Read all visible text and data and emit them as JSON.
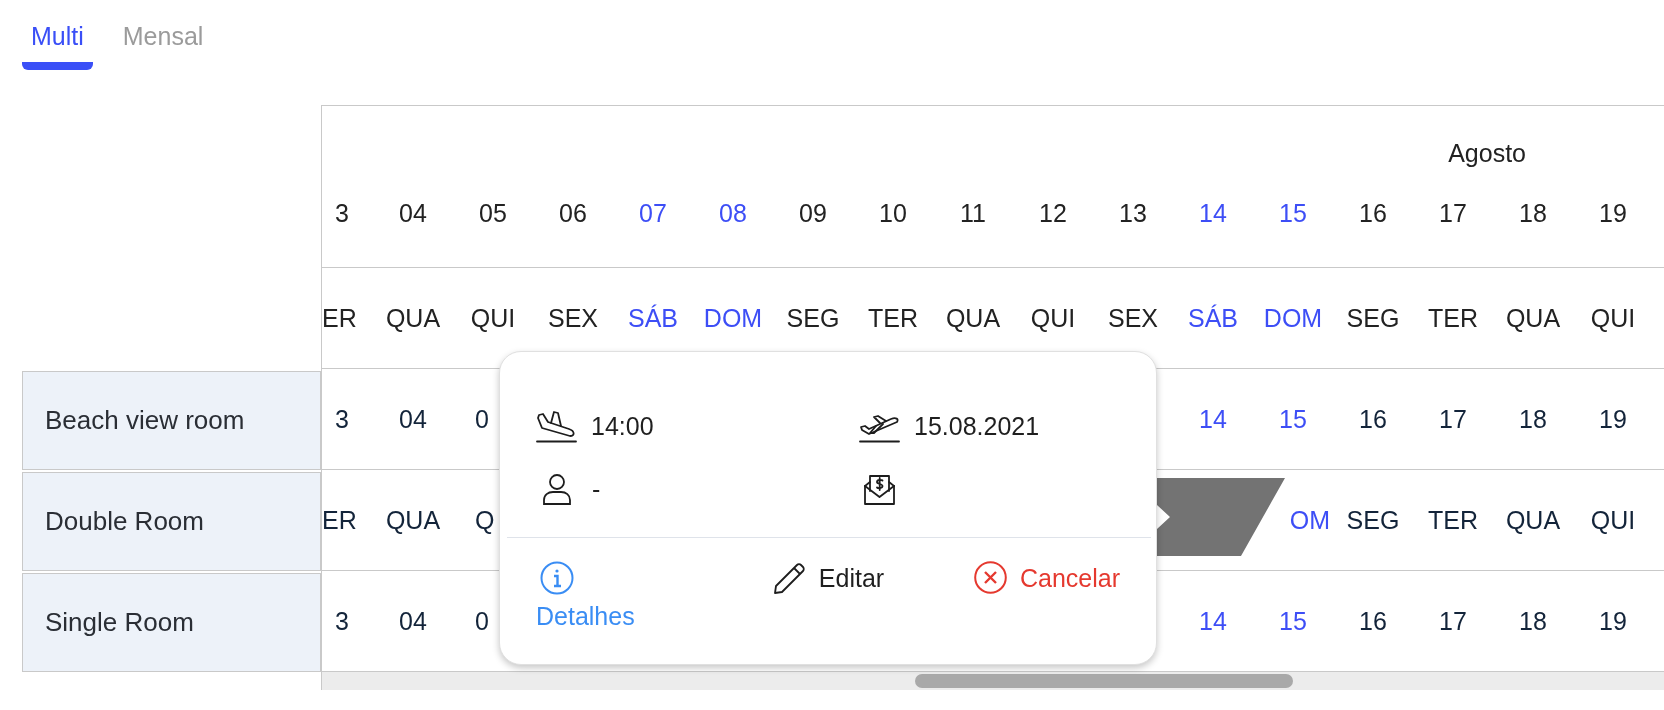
{
  "tabs": [
    {
      "label": "Multi",
      "selected": true
    },
    {
      "label": "Mensal",
      "selected": false
    }
  ],
  "calendar": {
    "months": [
      {
        "label": "Agosto"
      }
    ],
    "columns": [
      {
        "date": "3",
        "weekday": "ER",
        "weekend": false
      },
      {
        "date": "04",
        "weekday": "QUA",
        "weekend": false
      },
      {
        "date": "05",
        "weekday": "QUI",
        "weekend": false
      },
      {
        "date": "06",
        "weekday": "SEX",
        "weekend": false
      },
      {
        "date": "07",
        "weekday": "SÁB",
        "weekend": true
      },
      {
        "date": "08",
        "weekday": "DOM",
        "weekend": true
      },
      {
        "date": "09",
        "weekday": "SEG",
        "weekend": false
      },
      {
        "date": "10",
        "weekday": "TER",
        "weekend": false
      },
      {
        "date": "11",
        "weekday": "QUA",
        "weekend": false
      },
      {
        "date": "12",
        "weekday": "QUI",
        "weekend": false
      },
      {
        "date": "13",
        "weekday": "SEX",
        "weekend": false
      },
      {
        "date": "14",
        "weekday": "SÁB",
        "weekend": true
      },
      {
        "date": "15",
        "weekday": "DOM",
        "weekend": true
      },
      {
        "date": "16",
        "weekday": "SEG",
        "weekend": false
      },
      {
        "date": "17",
        "weekday": "TER",
        "weekend": false
      },
      {
        "date": "18",
        "weekday": "QUA",
        "weekend": false
      },
      {
        "date": "19",
        "weekday": "QUI",
        "weekend": false
      }
    ],
    "rooms": [
      {
        "name": "Beach view room",
        "booking_bar": false,
        "cells_start": [
          "3",
          "04",
          "0"
        ],
        "cells_end": [
          "14",
          "15",
          "16",
          "17",
          "18",
          "19"
        ]
      },
      {
        "name": "Double Room",
        "booking_bar": true,
        "cells_start": [
          "ER",
          "QUA",
          "Q"
        ],
        "cells_end": [
          "OM",
          "SEG",
          "TER",
          "QUA",
          "QUI"
        ]
      },
      {
        "name": "Single Room",
        "booking_bar": false,
        "cells_start": [
          "3",
          "04",
          "0"
        ],
        "cells_end": [
          "14",
          "15",
          "16",
          "17",
          "18",
          "19"
        ]
      }
    ]
  },
  "popup": {
    "arrival": "14:00",
    "departure": "15.08.2021",
    "guest": "-",
    "actions": [
      {
        "label": "Detalhes",
        "kind": "info"
      },
      {
        "label": "Editar",
        "kind": "edit"
      },
      {
        "label": "Cancelar",
        "kind": "cancel"
      }
    ]
  }
}
